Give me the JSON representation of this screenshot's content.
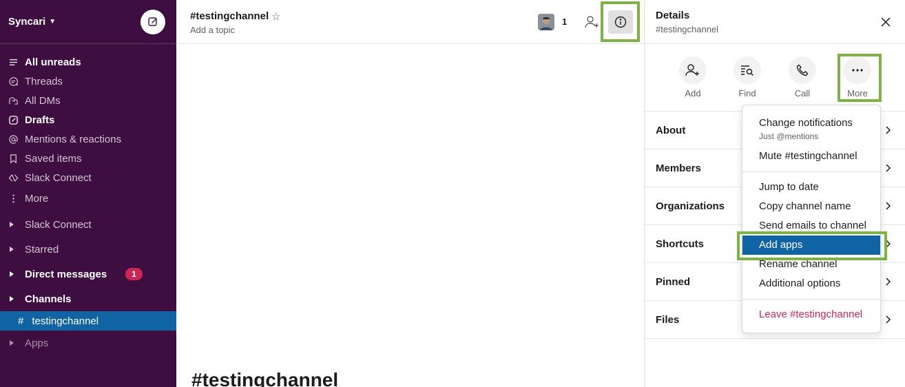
{
  "workspace": {
    "name": "Syncari"
  },
  "sidebar": {
    "nav": [
      {
        "label": "All unreads",
        "icon": "all-unreads-icon",
        "bold": true
      },
      {
        "label": "Threads",
        "icon": "threads-icon",
        "bold": false
      },
      {
        "label": "All DMs",
        "icon": "all-dms-icon",
        "bold": false
      },
      {
        "label": "Drafts",
        "icon": "drafts-icon",
        "bold": true
      },
      {
        "label": "Mentions & reactions",
        "icon": "mentions-icon",
        "bold": false
      },
      {
        "label": "Saved items",
        "icon": "bookmark-icon",
        "bold": false
      },
      {
        "label": "Slack Connect",
        "icon": "slack-connect-icon",
        "bold": false
      },
      {
        "label": "More",
        "icon": "more-vertical-icon",
        "bold": false
      }
    ],
    "sections": {
      "slack_connect": "Slack Connect",
      "starred": "Starred",
      "direct_messages": "Direct messages",
      "direct_messages_badge": "1",
      "channels": "Channels",
      "apps": "Apps"
    },
    "channel": {
      "hash": "#",
      "name": "testingchannel"
    }
  },
  "channel_header": {
    "name": "#testingchannel",
    "topic": "Add a topic",
    "member_count": "1"
  },
  "main": {
    "title": "#testingchannel"
  },
  "details": {
    "title": "Details",
    "subtitle": "#testingchannel",
    "actions": [
      {
        "label": "Add",
        "icon": "add-person-icon"
      },
      {
        "label": "Find",
        "icon": "find-icon"
      },
      {
        "label": "Call",
        "icon": "phone-icon"
      },
      {
        "label": "More",
        "icon": "more-horizontal-icon"
      }
    ],
    "rows": [
      "About",
      "Members",
      "Organizations",
      "Shortcuts",
      "Pinned",
      "Files"
    ]
  },
  "menu": {
    "change_notifications": "Change notifications",
    "change_notifications_sub": "Just @mentions",
    "mute": "Mute #testingchannel",
    "jump_to_date": "Jump to date",
    "copy_name": "Copy channel name",
    "send_emails": "Send emails to channel",
    "add_apps": "Add apps",
    "rename": "Rename channel",
    "additional": "Additional options",
    "leave": "Leave #testingchannel"
  },
  "colors": {
    "sidebar_bg": "#3f0e40",
    "active_blue": "#1164a3",
    "highlight_green": "#7cb342",
    "badge_red": "#cd2553",
    "danger": "#e01e5a"
  }
}
